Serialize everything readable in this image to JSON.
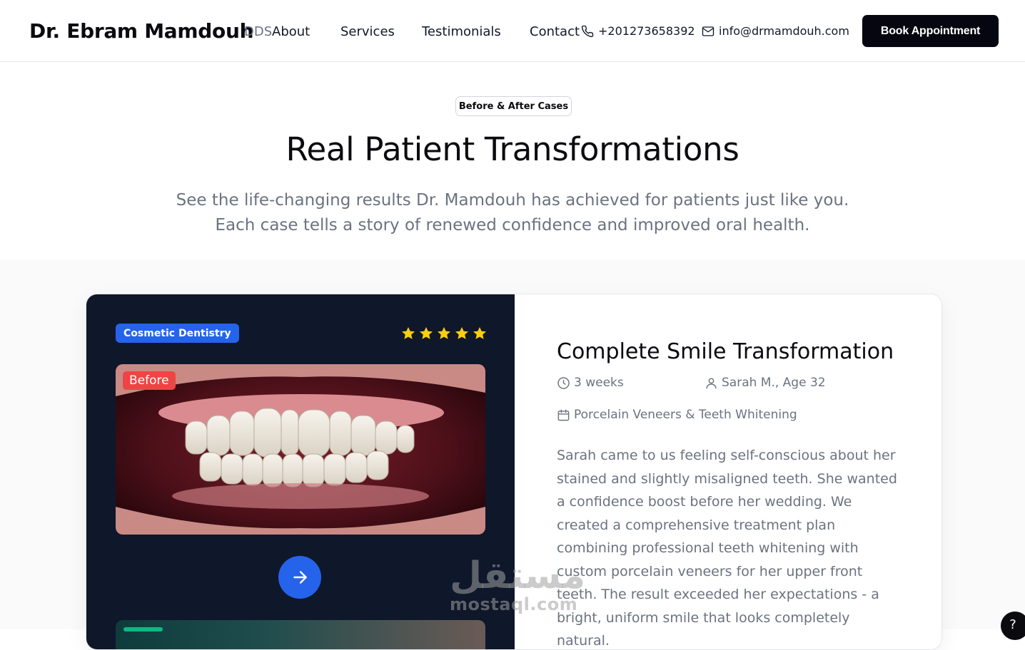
{
  "header": {
    "brand": "Dr. Ebram Mamdouh",
    "brand_suffix": "DDS",
    "nav": [
      "About",
      "Services",
      "Testimonials",
      "Contact"
    ],
    "phone": "+201273658392",
    "email": "info@drmamdouh.com",
    "cta": "Book Appointment"
  },
  "intro": {
    "pill": "Before & After Cases",
    "title": "Real Patient Transformations",
    "subtitle": "See the life-changing results Dr. Mamdouh has achieved for patients just like you. Each case tells a story of renewed confidence and improved oral health."
  },
  "case": {
    "category": "Cosmetic Dentistry",
    "rating": 5,
    "image_tag": "Before",
    "title": "Complete Smile Transformation",
    "duration": "3 weeks",
    "patient": "Sarah M., Age 32",
    "treatment": "Porcelain Veneers & Teeth Whitening",
    "description": "Sarah came to us feeling self-conscious about her stained and slightly misaligned teeth. She wanted a confidence boost before her wedding. We created a comprehensive treatment plan combining professional teeth whitening with custom porcelain veneers for her upper front teeth. The result exceeded her expectations - a bright, uniform smile that looks completely natural."
  },
  "help": "?",
  "watermark": {
    "arabic": "مستقل",
    "latin": "mostaql.com"
  },
  "colors": {
    "accent": "#2563eb",
    "dark_panel": "#0f172a",
    "before_tag": "#ef4444",
    "star": "#facc15"
  }
}
